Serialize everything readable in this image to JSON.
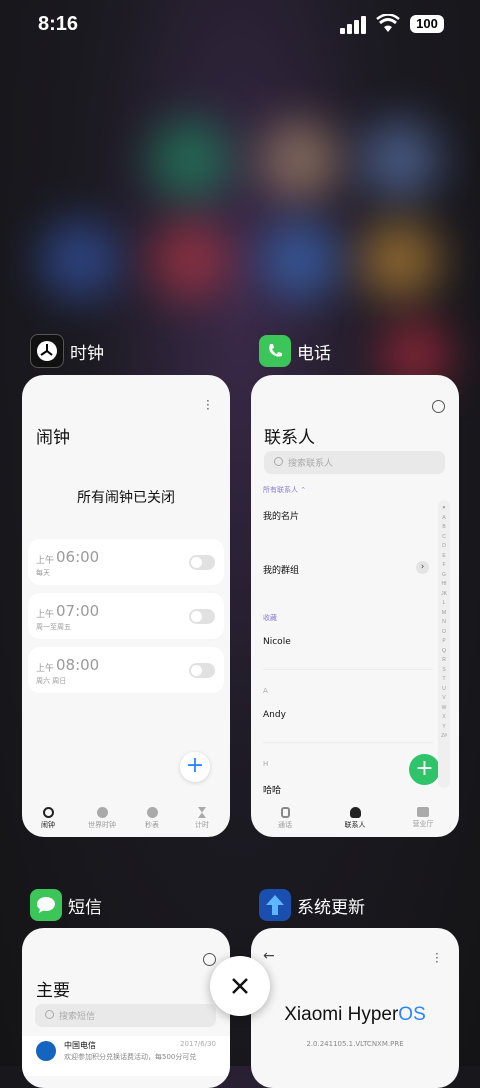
{
  "status_bar": {
    "time": "8:16",
    "battery": "100"
  },
  "clock_app": {
    "app_name": "时钟",
    "title": "闹钟",
    "message": "所有闹钟已关闭",
    "alarms": [
      {
        "period": "上午",
        "time": "06:00",
        "repeat": "每天"
      },
      {
        "period": "上午",
        "time": "07:00",
        "repeat": "周一至周五"
      },
      {
        "period": "上午",
        "time": "08:00",
        "repeat": "周六 周日"
      }
    ],
    "tabs": [
      "闹钟",
      "世界时钟",
      "秒表",
      "计时"
    ]
  },
  "phone_app": {
    "app_name": "电话",
    "title": "联系人",
    "search_placeholder": "搜索联系人",
    "filter": "所有联系人 ⌃",
    "my_card": "我的名片",
    "my_groups": "我的群组",
    "favorites_header": "收藏",
    "favorites": [
      "Nicole"
    ],
    "section_a": "A",
    "contact_a": "Andy",
    "section_h": "H",
    "contact_h": "哈哈",
    "alphabet": "♥ABCDEFGHIJKLMNOPQRSTUVWXYZ#",
    "tabs": [
      "通话",
      "联系人",
      "营业厅"
    ]
  },
  "sms_app": {
    "app_name": "短信",
    "title": "主要",
    "search_placeholder": "搜索短信",
    "message_sender": "中国电信",
    "message_date": "2017/6/30",
    "message_preview": "欢迎参加积分兑换话费活动，每500分可兑"
  },
  "update_app": {
    "app_name": "系统更新",
    "brand_prefix": "Xiaomi Hyper",
    "brand_suffix": "OS",
    "version": "2.0.241105.1.VLTCNXM.PRE"
  },
  "colors": {
    "accent_green": "#2fc36a",
    "accent_blue": "#2a86ff",
    "accent_purple": "#8c7ad8"
  }
}
